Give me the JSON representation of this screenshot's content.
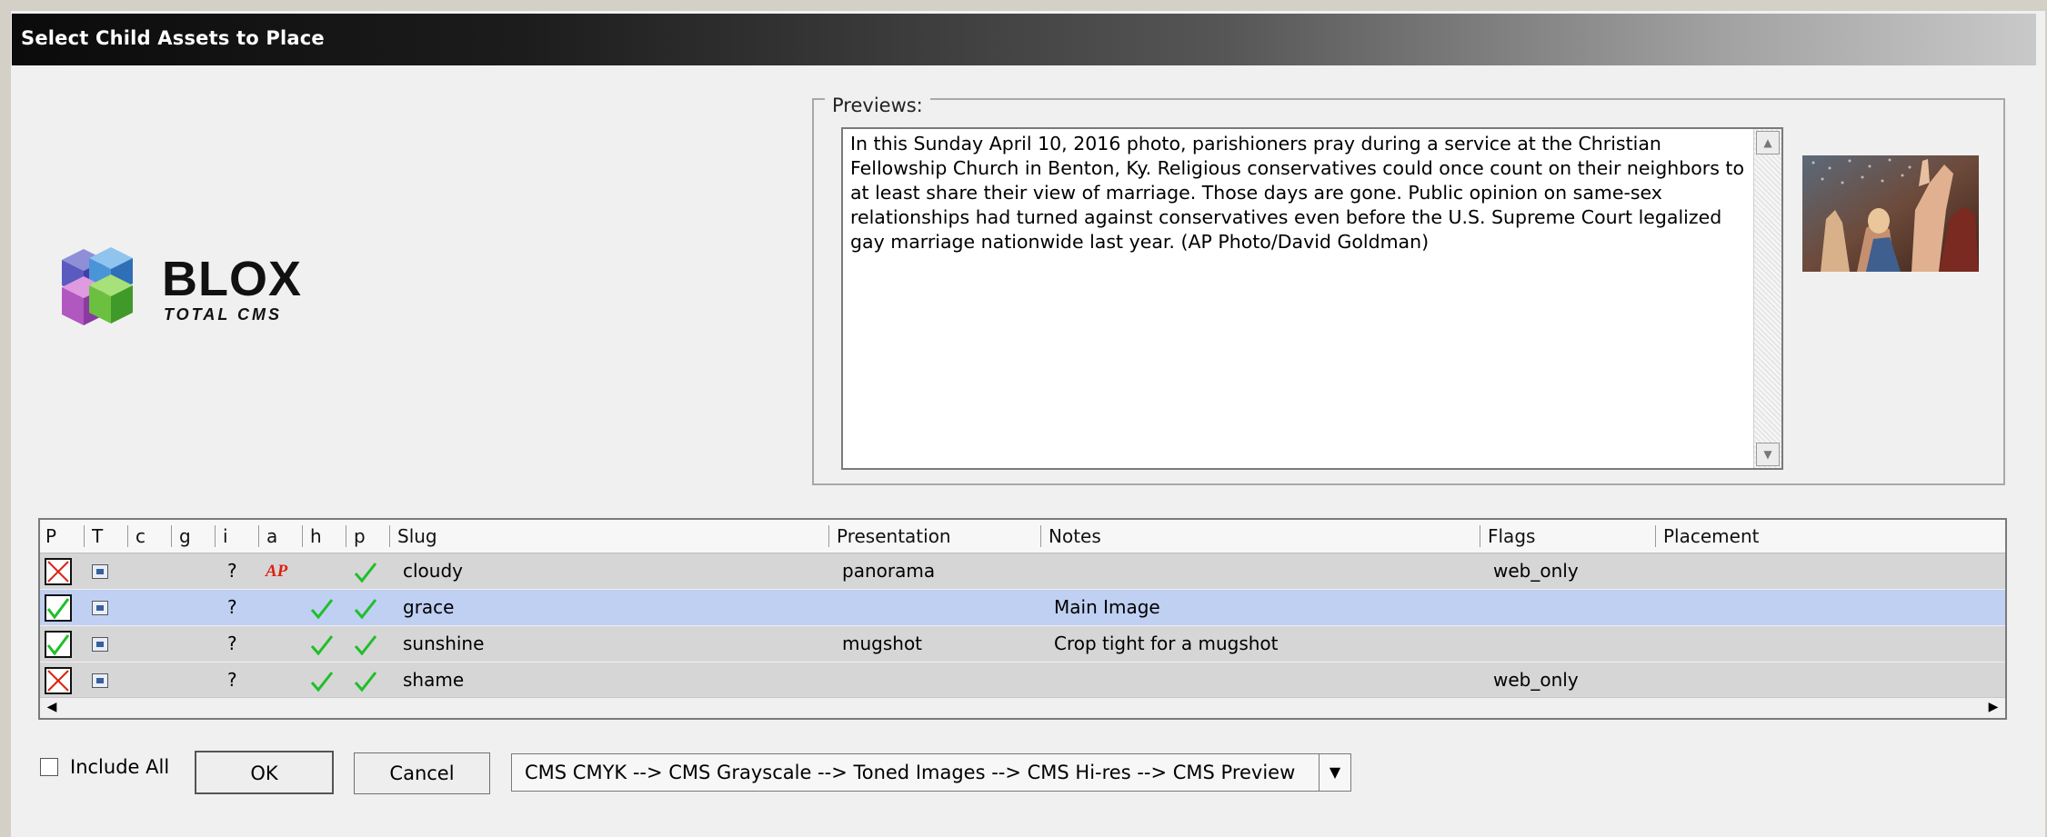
{
  "window": {
    "title": "Select Child Assets to Place"
  },
  "logo": {
    "word": "BLOX",
    "sub": "TOTAL CMS"
  },
  "previews": {
    "legend": "Previews:",
    "description": "In this Sunday April 10, 2016 photo, parishioners pray during a service at the Christian Fellowship Church in Benton, Ky. Religious conservatives could once count on their neighbors to at least share their view of marriage. Those days are gone. Public opinion on same-sex relationships had turned against conservatives even before the U.S. Supreme Court legalized gay marriage nationwide last year. (AP Photo/David Goldman)"
  },
  "table": {
    "columns": [
      "P",
      "T",
      "c",
      "g",
      "i",
      "a",
      "h",
      "p",
      "Slug",
      "Presentation",
      "Notes",
      "Flags",
      "Placement"
    ],
    "rows": [
      {
        "placed": false,
        "i": "?",
        "a": "AP",
        "h": false,
        "p": true,
        "slug": "cloudy",
        "presentation": "panorama",
        "notes": "",
        "flags": "web_only",
        "placement": "",
        "selected": false
      },
      {
        "placed": true,
        "i": "?",
        "a": "",
        "h": true,
        "p": true,
        "slug": "grace",
        "presentation": "",
        "notes": "Main Image",
        "flags": "",
        "placement": "",
        "selected": true
      },
      {
        "placed": true,
        "i": "?",
        "a": "",
        "h": true,
        "p": true,
        "slug": "sunshine",
        "presentation": "mugshot",
        "notes": "Crop tight for a mugshot",
        "flags": "",
        "placement": "",
        "selected": false
      },
      {
        "placed": false,
        "i": "?",
        "a": "",
        "h": true,
        "p": true,
        "slug": "shame",
        "presentation": "",
        "notes": "",
        "flags": "web_only",
        "placement": "",
        "selected": false
      }
    ]
  },
  "footer": {
    "include_all_label": "Include All",
    "ok_label": "OK",
    "cancel_label": "Cancel",
    "pipeline": "CMS CMYK --> CMS Grayscale --> Toned Images --> CMS Hi-res --> CMS Preview"
  }
}
